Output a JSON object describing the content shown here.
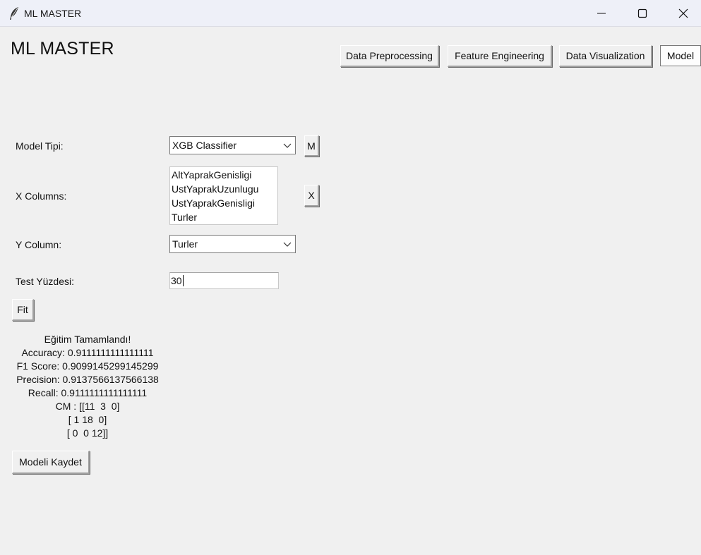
{
  "window": {
    "title": "ML MASTER",
    "icon": "feather-icon",
    "controls": [
      "minimize-icon",
      "maximize-icon",
      "close-icon"
    ]
  },
  "header": {
    "title": "ML MASTER"
  },
  "nav": {
    "data_preprocessing": "Data Preprocessing",
    "feature_engineering": "Feature Engineering",
    "data_visualization": "Data Visualization",
    "model": "Model"
  },
  "form": {
    "model_type_label": "Model Tipi:",
    "model_type_value": "XGB Classifier",
    "model_type_button": "M",
    "x_columns_label": "X Columns:",
    "x_columns_items": [
      "AltYaprakGenisligi",
      "UstYaprakUzunlugu",
      "UstYaprakGenisligi",
      "Turler"
    ],
    "x_columns_button": "X",
    "y_column_label": "Y Column:",
    "y_column_value": "Turler",
    "test_label": "Test Yüzdesi:",
    "test_value": "30",
    "fit_button": "Fit"
  },
  "results": {
    "lines": [
      "Eğitim Tamamlandı!",
      "Accuracy: 0.9111111111111111",
      "F1 Score: 0.9099145299145299",
      "Precision: 0.9137566137566138",
      "Recall: 0.9111111111111111",
      "CM : [[11  3  0]",
      "[ 1 18  0]",
      "[ 0  0 12]]"
    ]
  },
  "save_button": "Modeli Kaydet"
}
